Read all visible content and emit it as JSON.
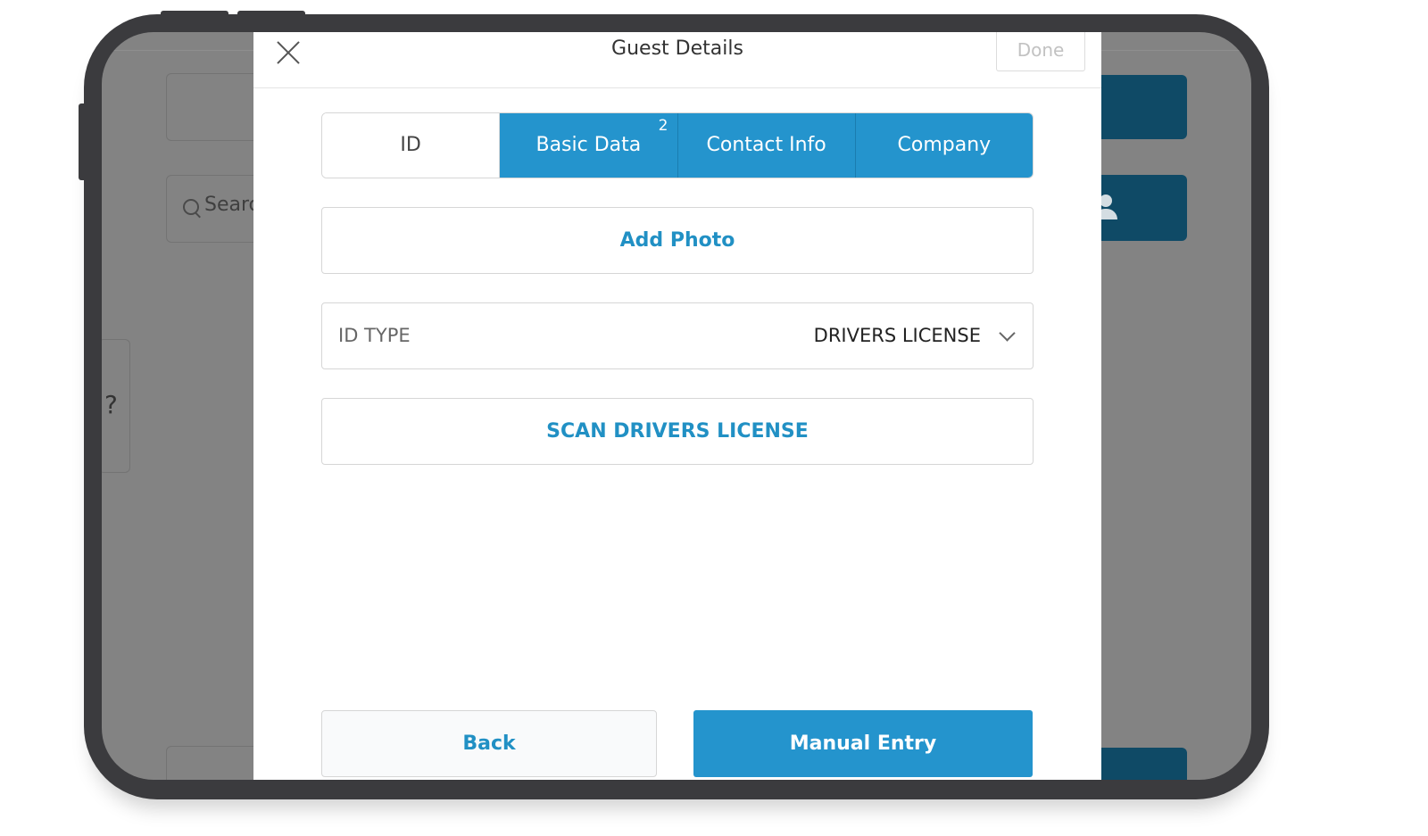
{
  "background_app": {
    "search_placeholder": "Searc",
    "help_label": "?"
  },
  "modal": {
    "title": "Guest Details",
    "done_label": "Done",
    "tabs": [
      {
        "label": "ID",
        "active": false
      },
      {
        "label": "Basic Data",
        "badge": "2",
        "active": true
      },
      {
        "label": "Contact Info",
        "active": true
      },
      {
        "label": "Company",
        "active": true
      }
    ],
    "add_photo_label": "Add Photo",
    "id_type": {
      "label": "ID TYPE",
      "value": "DRIVERS LICENSE"
    },
    "scan_label": "SCAN DRIVERS LICENSE",
    "back_label": "Back",
    "manual_entry_label": "Manual Entry"
  },
  "colors": {
    "accent": "#2494cd",
    "link": "#2190c4",
    "dim_background": "#838383",
    "background_button": "#0f4a66"
  }
}
